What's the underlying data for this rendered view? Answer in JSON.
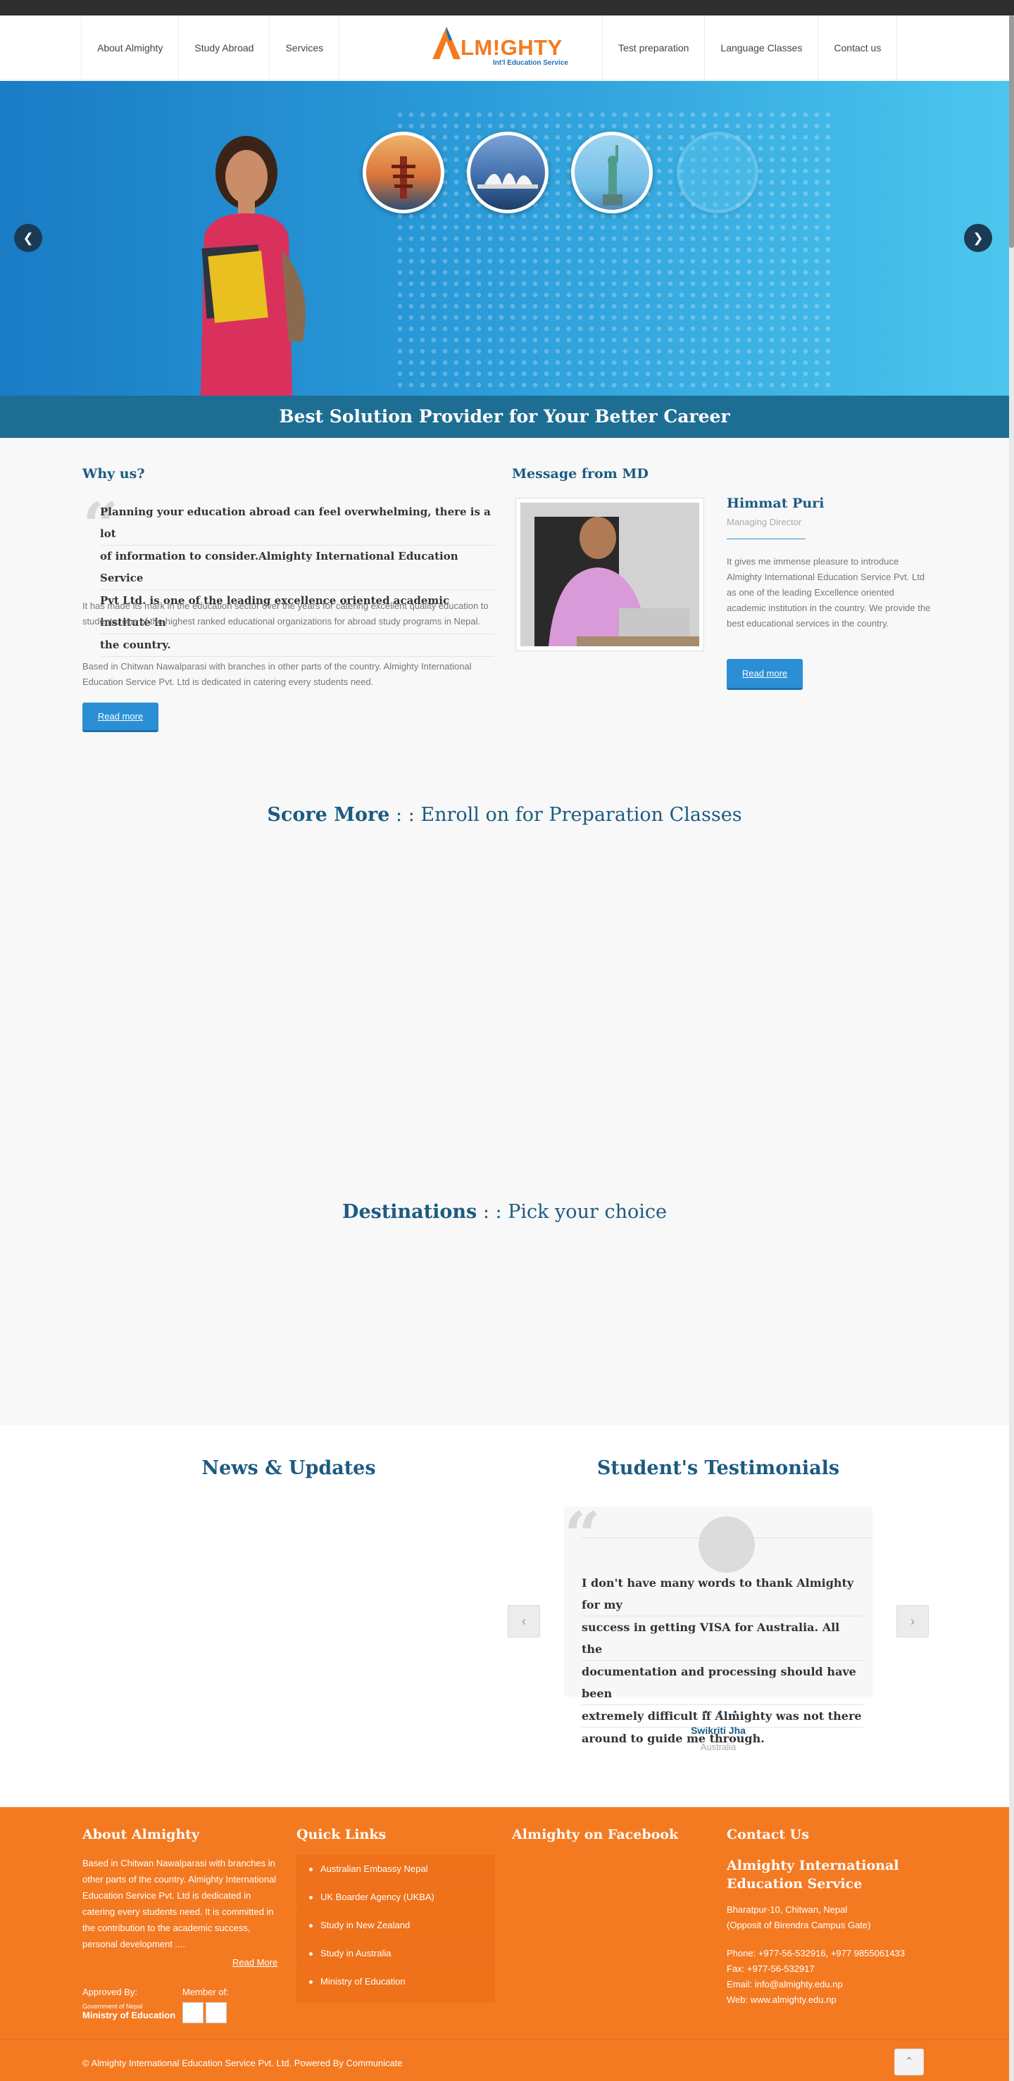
{
  "header": {
    "nav_left": [
      "About Almighty",
      "Study Abroad",
      "Services"
    ],
    "nav_right": [
      "Test preparation",
      "Language Classes",
      "Contact us"
    ],
    "logo_word": "LM!GHTY",
    "logo_tagline": "Int'l Education Service"
  },
  "hero": {
    "banner_text": "Best Solution Provider for Your Better Career",
    "prev_icon": "chevron-left-icon",
    "next_icon": "chevron-right-icon"
  },
  "why": {
    "heading": "Why us?",
    "lead_lines": [
      "Planning your education abroad can feel overwhelming, there is a lot",
      "of information to consider.Almighty International Education Service",
      "Pvt Ltd. is one of the leading excellence oriented academic institute in",
      "the country."
    ],
    "para1": "It has made its mark in the education sector over the years for catering excellent quality education to students. one of the highest ranked educational organizations for abroad study programs in Nepal.",
    "para2": "Based in Chitwan Nawalparasi with branches in other parts of the country. Almighty International Education Service Pvt. Ltd is dedicated in catering every students need.",
    "button": "Read more"
  },
  "md": {
    "heading": "Message from MD",
    "name": "Himmat Puri",
    "role": "Managing Director",
    "text": "It gives me immense pleasure to introduce Almighty International Education Service Pvt. Ltd as one of the leading Excellence oriented academic institution in the country. We provide the best educational services in the country.",
    "button": "Read more"
  },
  "score": {
    "bold": "Score More",
    "rest": " : : Enroll on for Preparation Classes"
  },
  "destinations": {
    "bold": "Destinations",
    "rest": " : : Pick your choice"
  },
  "news": {
    "heading": "News & Updates"
  },
  "testimonials": {
    "heading": "Student's Testimonials",
    "quote_lines": [
      "I don't have many words to thank Almighty for my",
      "success in getting VISA for Australia. All the",
      "documentation and processing should have been",
      "extremely difficult if Almighty was not there",
      "around to guide me through."
    ],
    "name": "Swikriti Jha",
    "country": "Australia",
    "dots": "• • •"
  },
  "footer": {
    "about_heading": "About Almighty",
    "about_text": "Based in Chitwan Nawalparasi with branches in other parts of the country. Almighty International Education Service Pvt. Ltd is dedicated in catering every students need. It is committed in the contribution to the academic success, personal development ....",
    "read_more": "Read More",
    "approved_by": "Approved By:",
    "member_of": "Member of:",
    "moe_small": "Government of Nepal",
    "moe_big": "Ministry of Education",
    "links_heading": "Quick Links",
    "links": [
      "Australian Embassy Nepal",
      "UK Boarder Agency (UKBA)",
      "Study in New Zealand",
      "Study in Australia",
      "Ministry of Education"
    ],
    "facebook_heading": "Almighty on Facebook",
    "contact_heading": "Contact Us",
    "company": "Almighty International Education Service",
    "address1": "Bharatpur-10, Chitwan, Nepal",
    "address2": "(Opposit of Birendra Campus Gate)",
    "phone": "Phone: +977-56-532916, +977 9855061433",
    "fax": "Fax: +977-56-532917",
    "email": "Email: info@almighty.edu.np",
    "web": "Web: www.almighty.edu.np",
    "copyright": "© Almighty International Education Service Pvt. Ltd. Powered By Communicate",
    "to_top_icon": "chevron-up-icon"
  },
  "colors": {
    "primary_blue": "#1c5b82",
    "button_blue": "#2b8fd6",
    "footer_orange": "#f47a22"
  }
}
